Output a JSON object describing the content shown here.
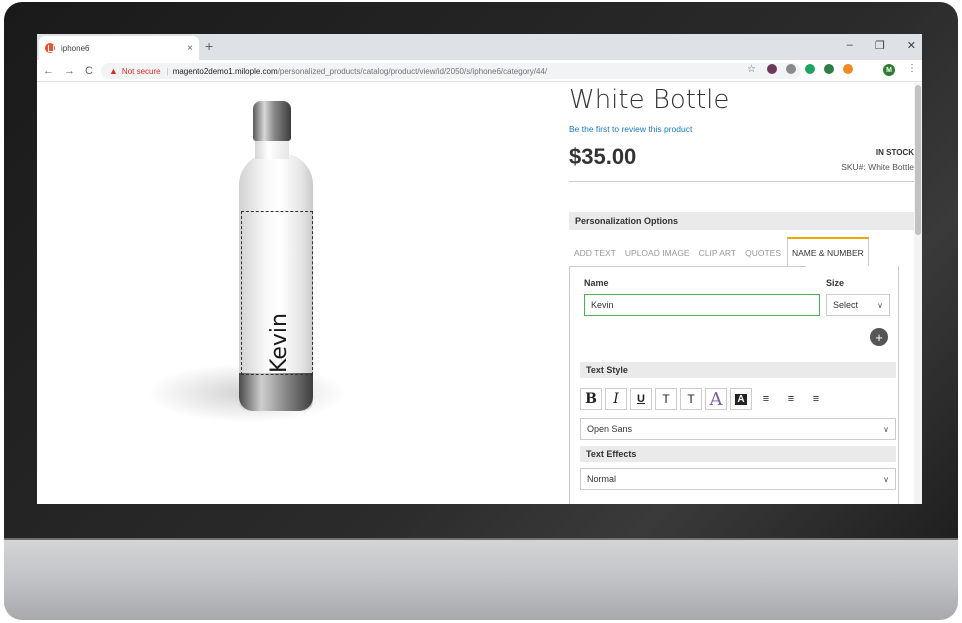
{
  "browser": {
    "tab_title": "iphone6",
    "tab_close": "×",
    "new_tab": "+",
    "window_controls": {
      "minimize": "–",
      "restore": "❐",
      "close": "✕"
    },
    "nav": {
      "back": "←",
      "forward": "→",
      "reload": "C"
    },
    "security_label": "Not secure",
    "url_host": "magento2demo1.milople.com",
    "url_path": "/personalized_products/catalog/product/view/id/2050/s/iphone6/category/44/",
    "star": "☆",
    "profile_initial": "M",
    "menu": "⋮",
    "extension_colors": [
      "#6b3a5a",
      "#8a8a8a",
      "#1ea362",
      "#2d7d46",
      "#f08a24"
    ]
  },
  "product": {
    "title": "White Bottle",
    "review_link": "Be the first to review this product",
    "price": "$35.00",
    "stock": "IN STOCK",
    "sku_label": "SKU#:",
    "sku_value": "White Bottle",
    "print_text": "Kevin"
  },
  "personalization": {
    "header": "Personalization Options",
    "tabs": [
      "ADD TEXT",
      "UPLOAD IMAGE",
      "CLIP ART",
      "QUOTES",
      "NAME & NUMBER"
    ],
    "active_tab": "NAME & NUMBER",
    "name_label": "Name",
    "name_value": "Kevin",
    "size_label": "Size",
    "size_value": "Select",
    "add_icon": "+",
    "text_style_label": "Text Style",
    "style_buttons": {
      "bold": "B",
      "italic": "I",
      "underline": "U",
      "size_a": "T",
      "size_b": "T",
      "font_color": "A",
      "bg_color": "A",
      "align_left": "≡",
      "align_center": "≡",
      "align_right": "≡"
    },
    "font_value": "Open Sans",
    "text_effects_label": "Text Effects",
    "effect_value": "Normal",
    "accent_color": "#f0a500",
    "input_border_color": "#4caf50"
  }
}
